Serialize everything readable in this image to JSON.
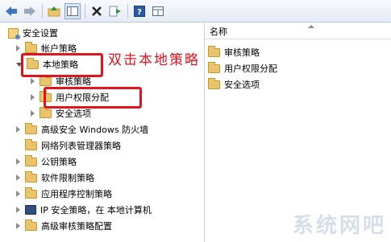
{
  "toolbar": {
    "buttons": [
      {
        "name": "back-icon"
      },
      {
        "name": "forward-icon"
      },
      {
        "name": "up-folder-icon"
      },
      {
        "name": "show-hide-tree-icon"
      },
      {
        "name": "delete-icon"
      },
      {
        "name": "export-list-icon"
      },
      {
        "name": "help-icon"
      },
      {
        "name": "properties-icon"
      }
    ]
  },
  "tree": {
    "root": "安全设置",
    "account_policy": "帐户策略",
    "local_policy": "本地策略",
    "audit_policy": "审核策略",
    "user_rights": "用户权限分配",
    "security_options": "安全选项",
    "firewall": "高级安全 Windows 防火墙",
    "network_list": "网络列表管理器策略",
    "public_key": "公钥策略",
    "software_restriction": "软件限制策略",
    "app_control": "应用程序控制策略",
    "ipsec": "IP 安全策略，在 本地计算机",
    "advanced_audit": "高级审核策略配置"
  },
  "list": {
    "header": "名称",
    "items": [
      "审核策略",
      "用户权限分配",
      "安全选项"
    ]
  },
  "annotation": "双击本地策略",
  "watermark": "系统网吧",
  "colors": {
    "highlight_red": "#e0141e",
    "folder": "#e9c46a"
  }
}
